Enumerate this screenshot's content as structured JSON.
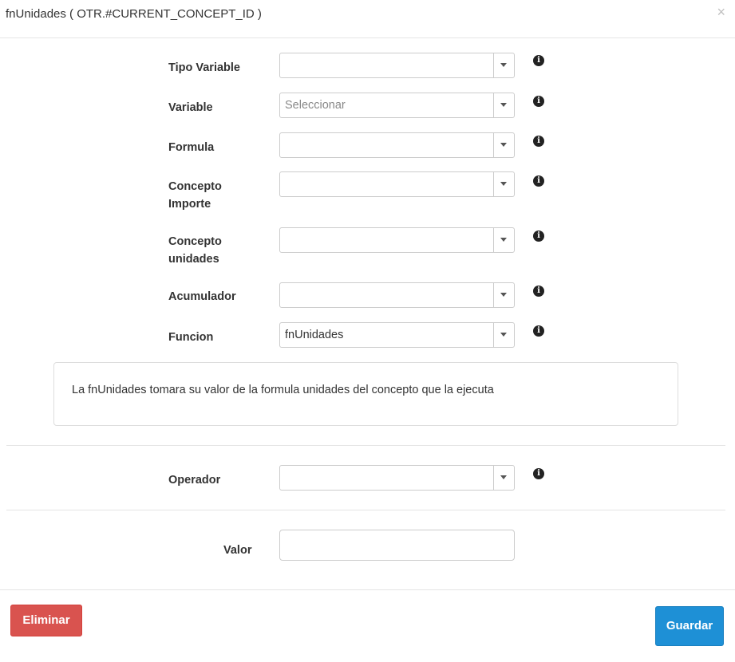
{
  "modal": {
    "title": "fnUnidades ( OTR.#CURRENT_CONCEPT_ID )",
    "close_glyph": "×"
  },
  "fields": {
    "tipo_variable": {
      "label": "Tipo Variable",
      "value": "",
      "placeholder": ""
    },
    "variable": {
      "label": "Variable",
      "value": "",
      "placeholder": "Seleccionar"
    },
    "formula": {
      "label": "Formula",
      "value": ""
    },
    "concepto_importe": {
      "label_line1": "Concepto",
      "label_line2": "Importe",
      "value": ""
    },
    "concepto_unidades": {
      "label_line1": "Concepto",
      "label_line2": "unidades",
      "value": ""
    },
    "acumulador": {
      "label": "Acumulador",
      "value": ""
    },
    "funcion": {
      "label": "Funcion",
      "value": "fnUnidades"
    },
    "operador": {
      "label": "Operador",
      "value": ""
    },
    "valor": {
      "label": "Valor",
      "value": ""
    }
  },
  "description": "La fnUnidades tomara su valor de la formula unidades del concepto que la ejecuta",
  "buttons": {
    "eliminar": "Eliminar",
    "guardar": "Guardar"
  },
  "icons": {
    "info": "info-circle-icon",
    "dropdown": "caret-down-icon",
    "close": "close-icon"
  },
  "colors": {
    "danger": "#d9534f",
    "primary": "#1e90d6"
  }
}
